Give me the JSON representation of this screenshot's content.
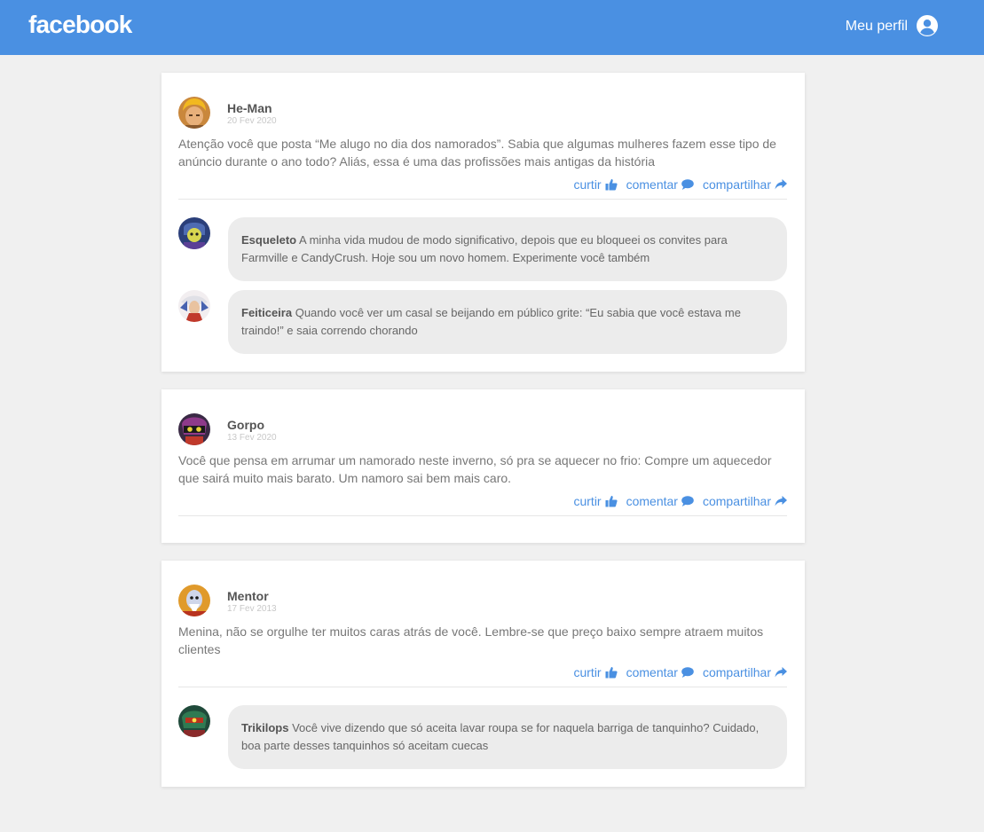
{
  "header": {
    "logo": "facebook",
    "profile_label": "Meu perfil"
  },
  "actions": {
    "like": "curtir",
    "comment": "comentar",
    "share": "compartilhar"
  },
  "posts": [
    {
      "author": "He-Man",
      "date": "20 Fev 2020",
      "content": "Atenção você que posta “Me alugo no dia dos namorados”. Sabia que algumas mulheres fazem esse tipo de anúncio durante o ano todo? Aliás, essa é uma das profissões mais antigas da história",
      "comments": [
        {
          "author": "Esqueleto",
          "text": "A minha vida mudou de modo significativo, depois que eu bloqueei os convites para Farmville e CandyCrush. Hoje sou um novo homem. Experimente você também"
        },
        {
          "author": "Feiticeira",
          "text": "Quando você ver um casal se beijando em público grite: “Eu sabia que você estava me traindo!” e saia correndo chorando"
        }
      ]
    },
    {
      "author": "Gorpo",
      "date": "13 Fev 2020",
      "content": "Você que pensa em arrumar um namorado neste inverno, só pra se aquecer no frio: Compre um aquecedor que sairá muito mais barato. Um namoro sai bem mais caro.",
      "comments": []
    },
    {
      "author": "Mentor",
      "date": "17 Fev 2013",
      "content": "Menina, não se orgulhe ter muitos caras atrás de você. Lembre-se que preço baixo sempre atraem muitos clientes",
      "comments": [
        {
          "author": "Trikilops",
          "text": "Você vive dizendo que só aceita lavar roupa se for naquela barriga de tanquinho? Cuidado, boa parte desses tanquinhos só aceitam cuecas"
        }
      ]
    }
  ],
  "colors": {
    "brand": "#4a90e2",
    "background": "#f0f0f0",
    "bubble": "#ececec"
  },
  "icons": {
    "profile": "user-circle-icon",
    "like": "thumbs-up-icon",
    "comment": "speech-bubble-icon",
    "share": "share-arrow-icon"
  }
}
